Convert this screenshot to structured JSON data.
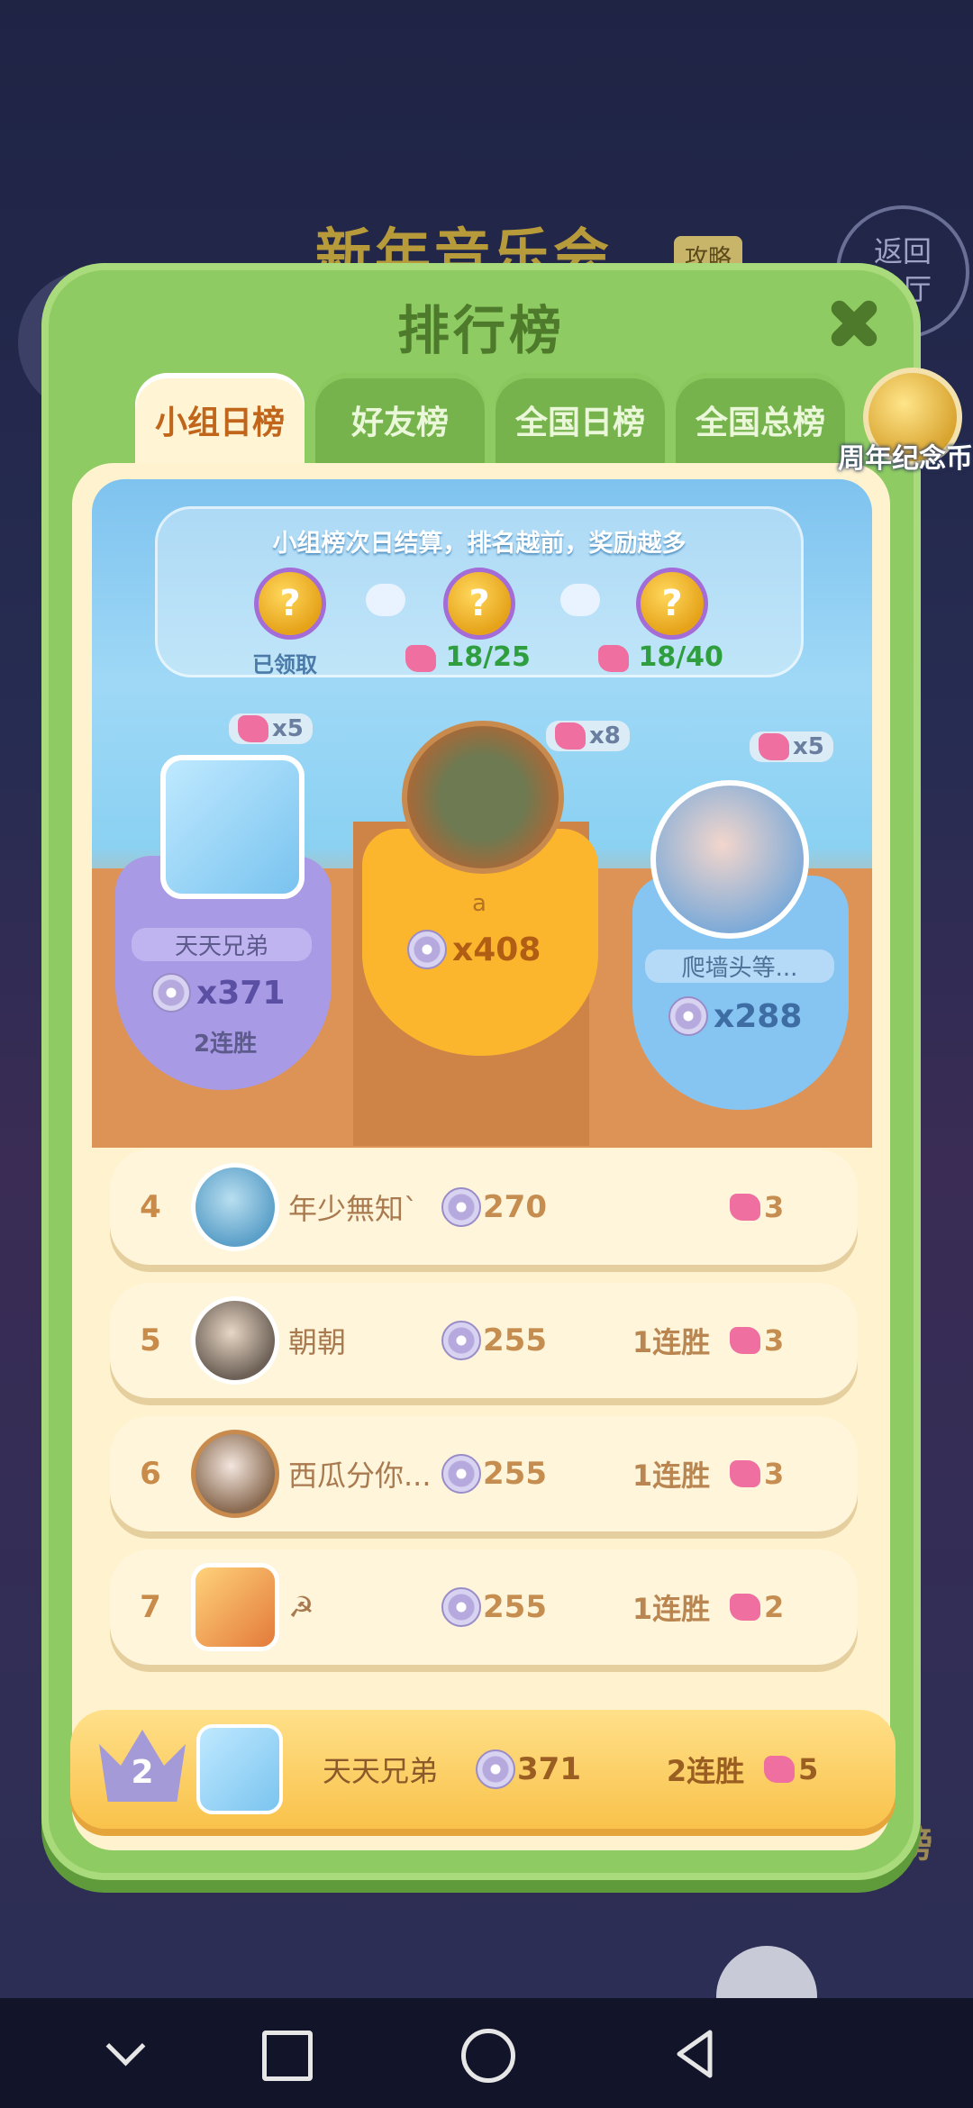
{
  "background": {
    "title": "新年音乐会",
    "guide_tag": "攻略",
    "back_button": "返回\n大厅",
    "right_label": "排行榜"
  },
  "modal": {
    "title": "排行榜",
    "tabs": [
      {
        "label": "小组日榜",
        "active": true
      },
      {
        "label": "好友榜",
        "active": false
      },
      {
        "label": "全国日榜",
        "active": false
      },
      {
        "label": "全国总榜",
        "active": false
      }
    ],
    "coin_badge_label": "周年纪念币",
    "info": {
      "text": "小组榜次日结算，排名越前，奖励越多",
      "chest_glyph": "?",
      "rewards": [
        {
          "status": "已领取"
        },
        {
          "progress": "18/25"
        },
        {
          "progress": "18/40"
        }
      ]
    },
    "podium": {
      "first": {
        "name": "a",
        "score": "x408",
        "pieces": "x8"
      },
      "second": {
        "name": "天天兄弟",
        "score": "x371",
        "streak": "2连胜",
        "pieces": "x5"
      },
      "third": {
        "name": "爬墙头等...",
        "score": "x288",
        "pieces": "x5"
      }
    },
    "rows": [
      {
        "rank": "4",
        "name": "年少無知`",
        "score": "270",
        "streak": "",
        "pieces": "3"
      },
      {
        "rank": "5",
        "name": "朝朝",
        "score": "255",
        "streak": "1连胜",
        "pieces": "3"
      },
      {
        "rank": "6",
        "name": "西瓜分你...",
        "score": "255",
        "streak": "1连胜",
        "pieces": "3"
      },
      {
        "rank": "7",
        "name": "☭",
        "score": "255",
        "streak": "1连胜",
        "pieces": "2"
      }
    ],
    "me": {
      "rank": "2",
      "name": "天天兄弟",
      "score": "371",
      "streak": "2连胜",
      "pieces": "5"
    }
  },
  "colors": {
    "modal_green": "#8fcb63",
    "active_tab_text": "#c1651b",
    "progress_green": "#2e9e3e",
    "my_row_yellow": "#f9c24a"
  }
}
